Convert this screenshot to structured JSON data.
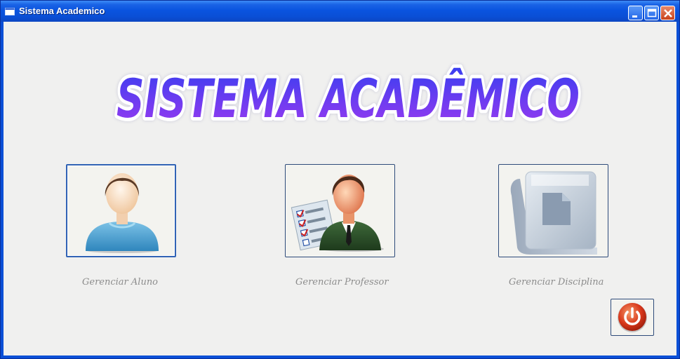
{
  "window": {
    "title": "Sistema Academico"
  },
  "logo": {
    "text": "SISTEMA ACADÊMICO"
  },
  "buttons": [
    {
      "label": "Gerenciar Aluno",
      "icon": "student-icon"
    },
    {
      "label": "Gerenciar Professor",
      "icon": "teacher-icon"
    },
    {
      "label": "Gerenciar Disciplina",
      "icon": "book-icon"
    }
  ],
  "exit": {
    "icon": "power-icon"
  },
  "colors": {
    "titlebar": "#0a54df",
    "logo_top": "#3a3ef0",
    "logo_bottom": "#9a3af0",
    "accent": "#d8371a"
  }
}
